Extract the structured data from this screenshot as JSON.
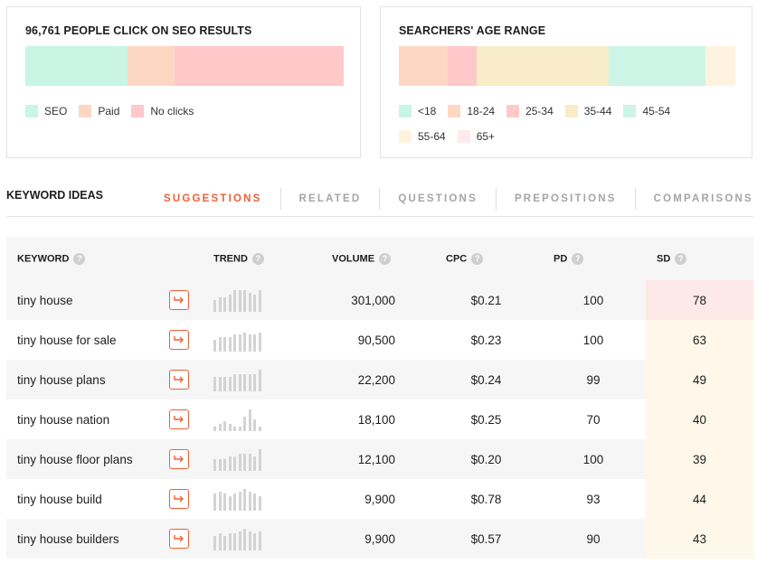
{
  "seo_card": {
    "title": "96,761 PEOPLE CLICK ON SEO RESULTS",
    "segments": [
      {
        "label": "SEO",
        "color": "#c8f5e4",
        "share": 32
      },
      {
        "label": "Paid",
        "color": "#fed7c3",
        "share": 15
      },
      {
        "label": "No clicks",
        "color": "#ffc9c9",
        "share": 53
      }
    ]
  },
  "age_card": {
    "title": "SEARCHERS' AGE RANGE",
    "segments": [
      {
        "label": "<18",
        "color": "#fed7c3",
        "share": 14.5
      },
      {
        "label": "18-24",
        "color": "#ffc9c9",
        "share": 8.5
      },
      {
        "label": "25-34",
        "color": "#f8edc8",
        "share": 39.5
      },
      {
        "label": "35-44",
        "color": "#ccf5e6",
        "share": 28.5
      },
      {
        "label": "45-54",
        "color": "#fff3e0",
        "share": 9
      },
      {
        "label": "55-64",
        "color": "#fff7ea",
        "share": 0
      },
      {
        "label": "65+",
        "color": "#fdeaea",
        "share": 0
      }
    ],
    "legend_colors": [
      "#c8f5e4",
      "#fed7c3",
      "#ffc9c9",
      "#f8edc8",
      "#ccf5e6",
      "#fff3e0",
      "#fdeaea"
    ],
    "legend_labels": [
      "<18",
      "18-24",
      "25-34",
      "35-44",
      "45-54",
      "55-64",
      "65+"
    ]
  },
  "keyword_ideas": {
    "title": "KEYWORD IDEAS",
    "tabs": [
      "SUGGESTIONS",
      "RELATED",
      "QUESTIONS",
      "PREPOSITIONS",
      "COMPARISONS"
    ],
    "active_tab": "SUGGESTIONS",
    "help_glyph": "?",
    "columns": [
      "KEYWORD",
      "TREND",
      "VOLUME",
      "CPC",
      "PD",
      "SD"
    ],
    "rows": [
      {
        "keyword": "tiny house",
        "volume": "301,000",
        "cpc": "$0.21",
        "pd": "100",
        "sd": "78",
        "trend": [
          5,
          6,
          6,
          7,
          9,
          9,
          9,
          8,
          7,
          9
        ]
      },
      {
        "keyword": "tiny house for sale",
        "volume": "90,500",
        "cpc": "$0.23",
        "pd": "100",
        "sd": "63",
        "trend": [
          5,
          6,
          6,
          6,
          7,
          7,
          8,
          7,
          7,
          8
        ]
      },
      {
        "keyword": "tiny house plans",
        "volume": "22,200",
        "cpc": "$0.24",
        "pd": "99",
        "sd": "49",
        "trend": [
          6,
          6,
          6,
          6,
          7,
          7,
          7,
          7,
          7,
          9
        ]
      },
      {
        "keyword": "tiny house nation",
        "volume": "18,100",
        "cpc": "$0.25",
        "pd": "70",
        "sd": "40",
        "trend": [
          2,
          3,
          4,
          3,
          2,
          2,
          6,
          9,
          5,
          2
        ]
      },
      {
        "keyword": "tiny house floor plans",
        "volume": "12,100",
        "cpc": "$0.20",
        "pd": "100",
        "sd": "39",
        "trend": [
          5,
          5,
          5,
          6,
          6,
          7,
          7,
          7,
          6,
          9
        ]
      },
      {
        "keyword": "tiny house build",
        "volume": "9,900",
        "cpc": "$0.78",
        "pd": "93",
        "sd": "44",
        "trend": [
          7,
          8,
          7,
          6,
          7,
          8,
          9,
          8,
          7,
          6
        ]
      },
      {
        "keyword": "tiny house builders",
        "volume": "9,900",
        "cpc": "$0.57",
        "pd": "90",
        "sd": "43",
        "trend": [
          6,
          7,
          6,
          7,
          7,
          8,
          9,
          8,
          7,
          8
        ]
      }
    ],
    "colors": {
      "accent": "#f05f33",
      "sd_high": "#fde9e7",
      "sd_mid": "#fff8ea"
    }
  }
}
